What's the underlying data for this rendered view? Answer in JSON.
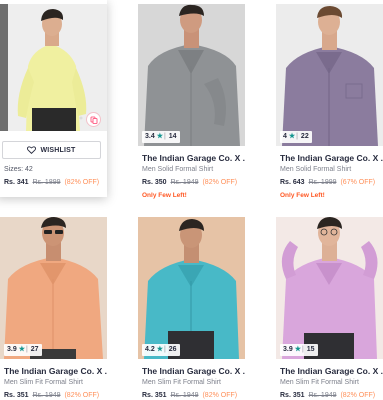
{
  "colors": {
    "rating_star": "#14958f",
    "discount": "#ff905a",
    "urgency": "#ff5722",
    "wishlist_heart": "#282c3f"
  },
  "products": [
    {
      "wishlist_label": "WISHLIST",
      "sizes": "Sizes: 42",
      "price": "Rs. 341",
      "mrp": "Rs. 1899",
      "discount": "(82% OFF)"
    },
    {
      "rating": "3.4",
      "rating_count": "14",
      "brand": "The Indian Garage Co. X ...",
      "subtitle": "Men Solid Formal Shirt",
      "price": "Rs. 350",
      "mrp": "Rs. 1949",
      "discount": "(82% OFF)",
      "few_left": "Only Few Left!"
    },
    {
      "rating": "4",
      "rating_count": "22",
      "brand": "The Indian Garage Co. X ...",
      "subtitle": "Men Solid Formal Shirt",
      "price": "Rs. 643",
      "mrp": "Rs. 1999",
      "discount": "(67% OFF)",
      "few_left": "Only Few Left!"
    },
    {
      "rating": "3.9",
      "rating_count": "27",
      "brand": "The Indian Garage Co. X ...",
      "subtitle": "Men Slim Fit Formal Shirt",
      "price": "Rs. 351",
      "mrp": "Rs. 1949",
      "discount": "(82% OFF)"
    },
    {
      "rating": "4.2",
      "rating_count": "26",
      "brand": "The Indian Garage Co. X ...",
      "subtitle": "Men Slim Fit Formal Shirt",
      "price": "Rs. 351",
      "mrp": "Rs. 1949",
      "discount": "(82% OFF)"
    },
    {
      "rating": "3.9",
      "rating_count": "15",
      "brand": "The Indian Garage Co. X ...",
      "subtitle": "Men Slim Fit Formal Shirt",
      "price": "Rs. 351",
      "mrp": "Rs. 1949",
      "discount": "(82% OFF)"
    }
  ]
}
